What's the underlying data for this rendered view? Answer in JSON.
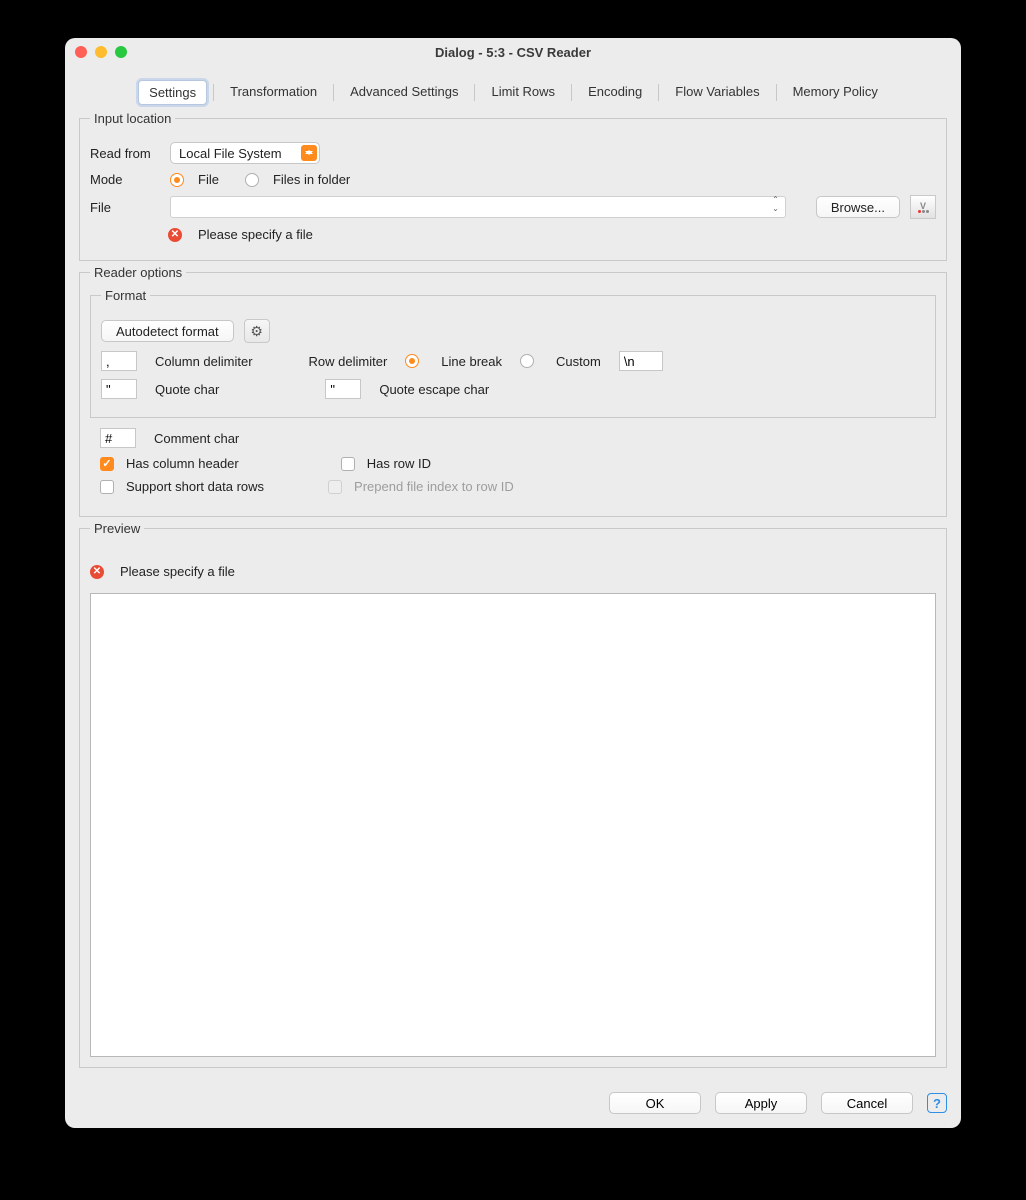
{
  "window": {
    "title": "Dialog - 5:3 - CSV Reader"
  },
  "tabs": [
    "Settings",
    "Transformation",
    "Advanced Settings",
    "Limit Rows",
    "Encoding",
    "Flow Variables",
    "Memory Policy"
  ],
  "activeTab": "Settings",
  "inputLocation": {
    "legend": "Input location",
    "readFromLabel": "Read from",
    "readFromValue": "Local File System",
    "modeLabel": "Mode",
    "modeFile": "File",
    "modeFiles": "Files in folder",
    "fileLabel": "File",
    "browse": "Browse...",
    "error": "Please specify a file"
  },
  "readerOptions": {
    "legend": "Reader options",
    "formatLegend": "Format",
    "autodetect": "Autodetect format",
    "colDelimLabel": "Column delimiter",
    "colDelimValue": ",",
    "rowDelimLabel": "Row delimiter",
    "lineBreak": "Line break",
    "custom": "Custom",
    "customValue": "\\n",
    "quoteCharLabel": "Quote char",
    "quoteCharValue": "\"",
    "quoteEscLabel": "Quote escape char",
    "quoteEscValue": "\"",
    "commentCharLabel": "Comment char",
    "commentCharValue": "#",
    "hasColHeader": "Has column header",
    "hasRowId": "Has row ID",
    "supportShort": "Support short data rows",
    "prependIdx": "Prepend file index to row ID"
  },
  "preview": {
    "legend": "Preview",
    "error": "Please specify a file"
  },
  "footer": {
    "ok": "OK",
    "apply": "Apply",
    "cancel": "Cancel"
  }
}
